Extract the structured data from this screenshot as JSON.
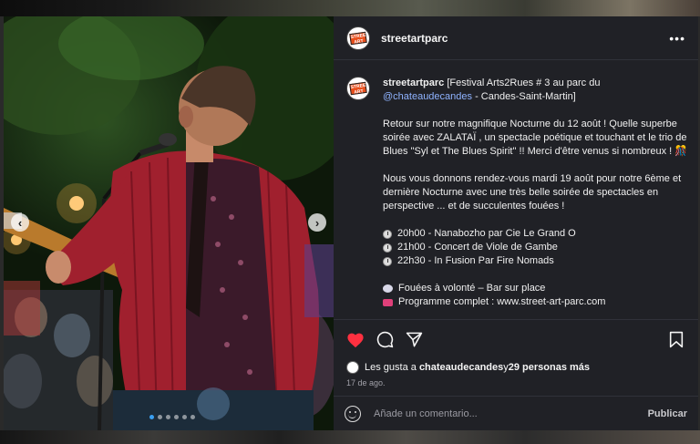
{
  "post": {
    "username": "streetartparc",
    "more_label": "•••",
    "avatar_logo_text": "STREET ART PARC"
  },
  "caption": {
    "username": "streetartparc",
    "intro": " [Festival Arts2Rues # 3 au parc du ",
    "mention": "@chateaudecandes",
    "intro_end": " - Candes-Saint-Martin]",
    "para1": "Retour sur notre magnifique Nocturne du 12 août ! Quelle superbe soirée avec ZALATAÏ , un spectacle poétique et touchant et le trio de Blues \"Syl et The Blues Spirit\" !! Merci d'être venus si nombreux ! 🎊",
    "para2": "Nous vous donnons rendez-vous mardi 19 août pour notre 6ème et dernière Nocturne avec une très belle soirée de spectacles en perspective ... et de succulentes fouées !",
    "schedule": [
      "20h00 - Nanabozho par Cie Le Grand O",
      "21h00 - Concert de Viole de Gambe",
      "22h30 - In Fusion Par Fire Nomads"
    ],
    "foods": "Fouées à volonté – Bar sur place",
    "program": "Programme complet : www.street-art-parc.com"
  },
  "likes": {
    "prefix": "Les gusta a ",
    "user": "chateaudecandes",
    "middle": " y ",
    "count_text": "29 personas más"
  },
  "date": "17 de ago.",
  "comment": {
    "placeholder": "Añade un comentario...",
    "publish_label": "Publicar"
  },
  "carousel": {
    "prev_label": "‹",
    "next_label": "›",
    "dots_total": 6,
    "active_dot": 0
  },
  "colors": {
    "like_heart": "#ff3040",
    "mention": "#8fb3ff",
    "dot_active": "#3a9ff0"
  }
}
